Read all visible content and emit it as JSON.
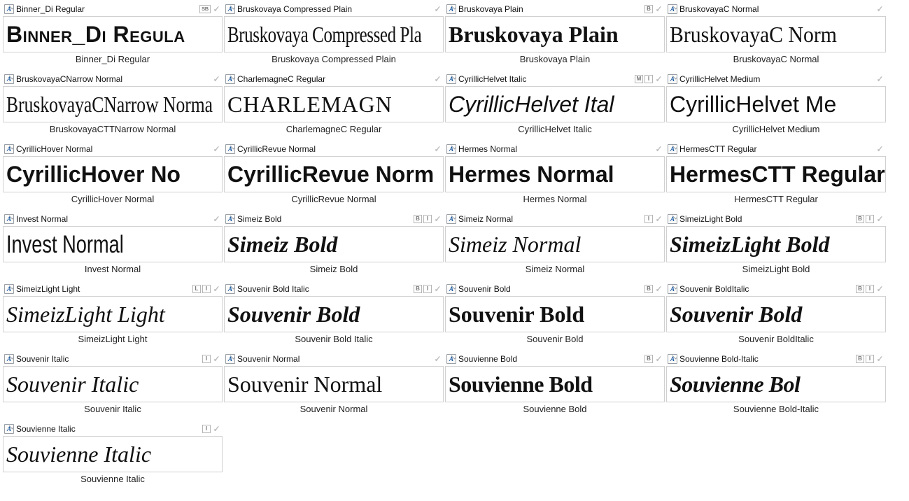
{
  "iconGlyph": "A",
  "fonts": [
    {
      "title": "Binner_Di Regular",
      "preview": "Binner_Di Regula",
      "caption": "Binner_Di Regular",
      "style": "f-binner",
      "badges": [
        "SB"
      ]
    },
    {
      "title": "Bruskovaya Compressed Plain",
      "preview": "Bruskovaya Compressed Pla",
      "caption": "Bruskovaya Compressed Plain",
      "style": "f-brusk-comp",
      "badges": []
    },
    {
      "title": "Bruskovaya Plain",
      "preview": "Bruskovaya Plain",
      "caption": "Bruskovaya Plain",
      "style": "f-brusk-plain",
      "badges": [
        "B"
      ]
    },
    {
      "title": "BruskovayaC Normal",
      "preview": "BruskovayaC Norm",
      "caption": "BruskovayaC Normal",
      "style": "f-bruskC",
      "badges": []
    },
    {
      "title": "BruskovayaCNarrow Normal",
      "preview": "BruskovayaCNarrow Norma",
      "caption": "BruskovayaCTTNarrow Normal",
      "style": "f-bruskCN",
      "badges": []
    },
    {
      "title": "CharlemagneC Regular",
      "preview": "CHARLEMAGN",
      "caption": "CharlemagneC Regular",
      "style": "f-charlemagne",
      "badges": []
    },
    {
      "title": "CyrillicHelvet Italic",
      "preview": "CyrillicHelvet Ital",
      "caption": "CyrillicHelvet Italic",
      "style": "f-cyrhelvet-it",
      "badges": [
        "M",
        "I"
      ]
    },
    {
      "title": "CyrillicHelvet Medium",
      "preview": "CyrillicHelvet Me",
      "caption": "CyrillicHelvet Medium",
      "style": "f-cyrhelvet-med",
      "badges": []
    },
    {
      "title": "CyrillicHover Normal",
      "preview": "CyrillicHover No",
      "caption": "CyrillicHover Normal",
      "style": "f-cyrhover",
      "badges": []
    },
    {
      "title": "CyrillicRevue Normal",
      "preview": "CyrillicRevue Norm",
      "caption": "CyrillicRevue Normal",
      "style": "f-cyrrevue",
      "badges": []
    },
    {
      "title": "Hermes Normal",
      "preview": "Hermes Normal",
      "caption": "Hermes Normal",
      "style": "f-hermes",
      "badges": []
    },
    {
      "title": "HermesCTT Regular",
      "preview": "HermesCTT Regular",
      "caption": "HermesCTT Regular",
      "style": "f-hermesctt",
      "badges": []
    },
    {
      "title": "Invest Normal",
      "preview": "Invest   Normal",
      "caption": "Invest Normal",
      "style": "f-invest",
      "badges": []
    },
    {
      "title": "Simeiz Bold",
      "preview": "Simeiz  Bold",
      "caption": "Simeiz Bold",
      "style": "f-simeiz-bold",
      "badges": [
        "B",
        "I"
      ]
    },
    {
      "title": "Simeiz Normal",
      "preview": "Simeiz  Normal",
      "caption": "Simeiz Normal",
      "style": "f-simeiz",
      "badges": [
        "I"
      ]
    },
    {
      "title": "SimeizLight Bold",
      "preview": "SimeizLight  Bold",
      "caption": "SimeizLight Bold",
      "style": "f-simeizlight-b",
      "badges": [
        "B",
        "I"
      ]
    },
    {
      "title": "SimeizLight Light",
      "preview": "SimeizLight  Light",
      "caption": "SimeizLight Light",
      "style": "f-simeizlight",
      "badges": [
        "L",
        "I"
      ]
    },
    {
      "title": "Souvenir Bold Italic",
      "preview": "Souvenir  Bold",
      "caption": "Souvenir Bold Italic",
      "style": "f-souvenir-bi",
      "badges": [
        "B",
        "I"
      ]
    },
    {
      "title": "Souvenir Bold",
      "preview": "Souvenir Bold",
      "caption": "Souvenir Bold",
      "style": "f-souvenir-b",
      "badges": [
        "B"
      ]
    },
    {
      "title": "Souvenir BoldItalic",
      "preview": "Souvenir Bold",
      "caption": "Souvenir BoldItalic",
      "style": "f-souvenir-bi",
      "badges": [
        "B",
        "I"
      ]
    },
    {
      "title": "Souvenir Italic",
      "preview": "Souvenir Italic",
      "caption": "Souvenir Italic",
      "style": "f-souvenir-it",
      "badges": [
        "I"
      ]
    },
    {
      "title": "Souvenir Normal",
      "preview": "Souvenir Normal",
      "caption": "Souvenir Normal",
      "style": "f-souvenir",
      "badges": []
    },
    {
      "title": "Souvienne Bold",
      "preview": "Souvienne Bold",
      "caption": "Souvienne Bold",
      "style": "f-souvienne-b",
      "badges": [
        "B"
      ]
    },
    {
      "title": "Souvienne Bold-Italic",
      "preview": "Souvienne Bol",
      "caption": "Souvienne Bold-Italic",
      "style": "f-souvienne-bi",
      "badges": [
        "B",
        "I"
      ]
    },
    {
      "title": "Souvienne Italic",
      "preview": "Souvienne Italic",
      "caption": "Souvienne Italic",
      "style": "f-souvienne-it",
      "badges": [
        "I"
      ]
    }
  ]
}
